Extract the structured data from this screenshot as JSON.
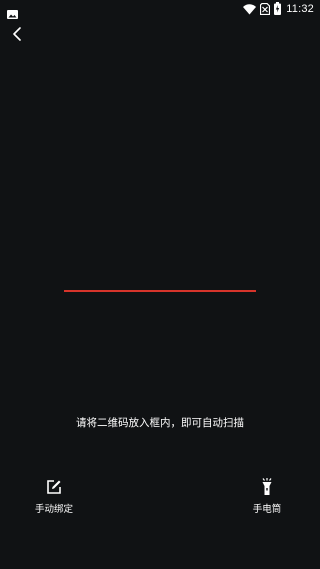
{
  "status_bar": {
    "time": "11:32",
    "left_icon": "image-icon",
    "icons": [
      "wifi-icon",
      "no-sim-icon",
      "battery-charging-icon"
    ]
  },
  "header": {
    "back_icon": "back-arrow-icon"
  },
  "scanner": {
    "hint": "请将二维码放入框内，即可自动扫描",
    "scan_line_color": "#d6342b"
  },
  "actions": {
    "manual_bind": {
      "label": "手动绑定",
      "icon": "edit-icon"
    },
    "flashlight": {
      "label": "手电筒",
      "icon": "flashlight-icon"
    }
  },
  "colors": {
    "background": "#101214",
    "text": "#ffffff"
  }
}
